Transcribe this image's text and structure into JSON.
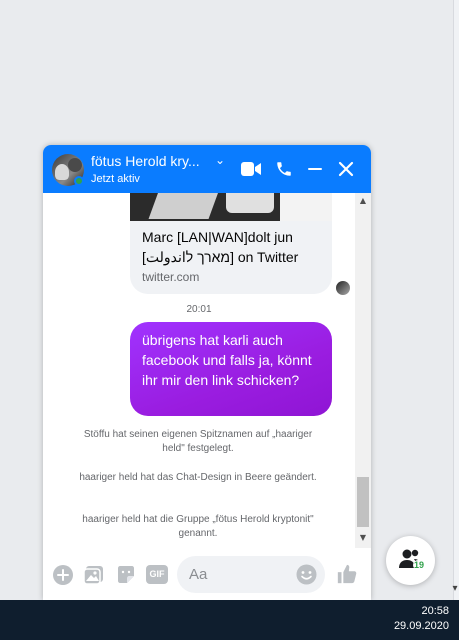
{
  "chat": {
    "title": "fötus Herold kry...",
    "status": "Jetzt aktiv",
    "link_card": {
      "title_line1": "Marc [LAN|WAN]dolt jun",
      "title_line2": "[מארך לاندولت] on Twitter",
      "domain": "twitter.com"
    },
    "timestamp": "20:01",
    "my_message": "übrigens hat karli auch facebook und falls ja, könnt ihr mir den link schicken?",
    "events": [
      "Stöffu hat seinen eigenen Spitznamen auf „haariger held\" festgelegt.",
      "haariger held hat das Chat-Design in Beere geändert.",
      "haariger held hat die Gruppe „fötus Herold kryptonit\" genannt."
    ],
    "input_placeholder": "Aa",
    "theme_color": "#0a7cff",
    "bubble_color": "#9a1de0"
  },
  "contacts": {
    "online_count": "19"
  },
  "taskbar": {
    "time": "20:58",
    "date": "29.09.2020"
  },
  "icons": {
    "header": [
      "video-camera-icon",
      "phone-icon",
      "minimize-icon",
      "close-icon"
    ],
    "composer": [
      "add-icon",
      "photo-icon",
      "sticker-icon",
      "gif-icon",
      "emoji-icon",
      "like-icon"
    ]
  }
}
